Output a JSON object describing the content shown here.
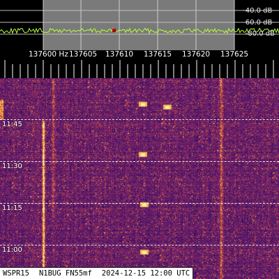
{
  "spectrum": {
    "db_labels": [
      "-40.0 dB-",
      "-60.0 dB-",
      "-80.0 dB"
    ],
    "passband_color": "#7a7a7a",
    "trace_color": "#b7ff3a",
    "marker_color": "#b00000"
  },
  "frequency_scale": {
    "labels": [
      "137600 Hz",
      "137605",
      "137610",
      "137615",
      "137620",
      "137625"
    ]
  },
  "waterfall": {
    "palette": "inferno",
    "time_labels": [
      "11:45",
      "11:30",
      "11:15",
      "11:00"
    ],
    "grid_color": "#ffffff"
  },
  "status_bar": {
    "mode": "WSPR15",
    "callsign_locator": "N1BUG FN55mf",
    "timestamp": "2024-12-15 12:00 UTC"
  }
}
